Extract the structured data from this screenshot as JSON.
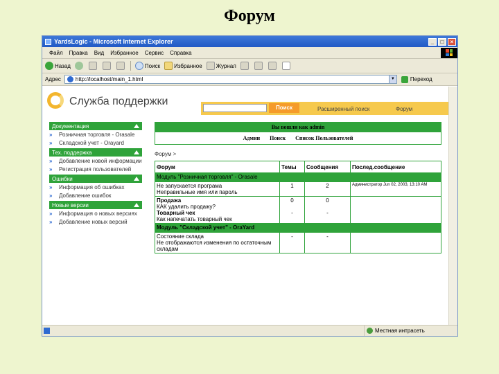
{
  "slide_title": "Форум",
  "window": {
    "title": "YardsLogic - Microsoft Internet Explorer"
  },
  "menu": [
    "Файл",
    "Правка",
    "Вид",
    "Избранное",
    "Сервис",
    "Справка"
  ],
  "toolbar": {
    "back": "Назад",
    "search": "Поиск",
    "favorites": "Избранное",
    "media": "Журнал"
  },
  "address": {
    "label": "Адрес",
    "url": "http://localhost/main_1.html",
    "go": "Переход"
  },
  "site": {
    "logo_text": "Служба поддержки",
    "search_button": "Поиск",
    "advanced_search": "Расширенный поиск",
    "forum_link": "Форум"
  },
  "sidebar": [
    {
      "title": "Документация",
      "items": [
        "Розничная торговля - Orasale",
        "Складской учет - Orayard"
      ]
    },
    {
      "title": "Тех. поддержка",
      "items": [
        "Добавление новой информации",
        "Регистрация пользователей"
      ]
    },
    {
      "title": "Ошибки",
      "items": [
        "Информация об ошибках",
        "Добавление ошибок"
      ]
    },
    {
      "title": "Новые версии",
      "items": [
        "Информация о новых версиях",
        "Добавление новых версий"
      ]
    }
  ],
  "welcome": {
    "text": "Вы вошли как admin",
    "links": [
      "Админ",
      "Поиск",
      "Список Пользователей"
    ]
  },
  "breadcrumb": "Форум >",
  "forum_table": {
    "headers": [
      "Форум",
      "Темы",
      "Сообщения",
      "Послед.сообщение"
    ],
    "groups": [
      {
        "title": "Модуль \"Розничная торговля\" - Orasale",
        "rows": [
          {
            "title": "Не запускается програма",
            "desc": "Неправильные имя или пароль",
            "topics": "1",
            "posts": "2",
            "last": "Администратор Jun 02, 2003, 13:10 AM"
          },
          {
            "title": "Продажа",
            "desc": "КАК удалить продажу?",
            "topics": "0",
            "posts": "0",
            "last": ""
          },
          {
            "title": "Товарный чек",
            "desc": "Как напечатать товарный чек",
            "topics": "-",
            "posts": "-",
            "last": ""
          }
        ]
      },
      {
        "title": "Модуль \"Складской учет\" - OraYard",
        "rows": [
          {
            "title": "Состояние склада",
            "desc": "Не отображаются изменения по остаточным складам",
            "topics": "-",
            "posts": "-",
            "last": ""
          }
        ]
      }
    ]
  },
  "status": {
    "zone": "Местная интрасеть"
  },
  "colors": {
    "accent_green": "#2fa33a",
    "page_bg": "#eef5cf",
    "search_band": "#f6c94d"
  }
}
